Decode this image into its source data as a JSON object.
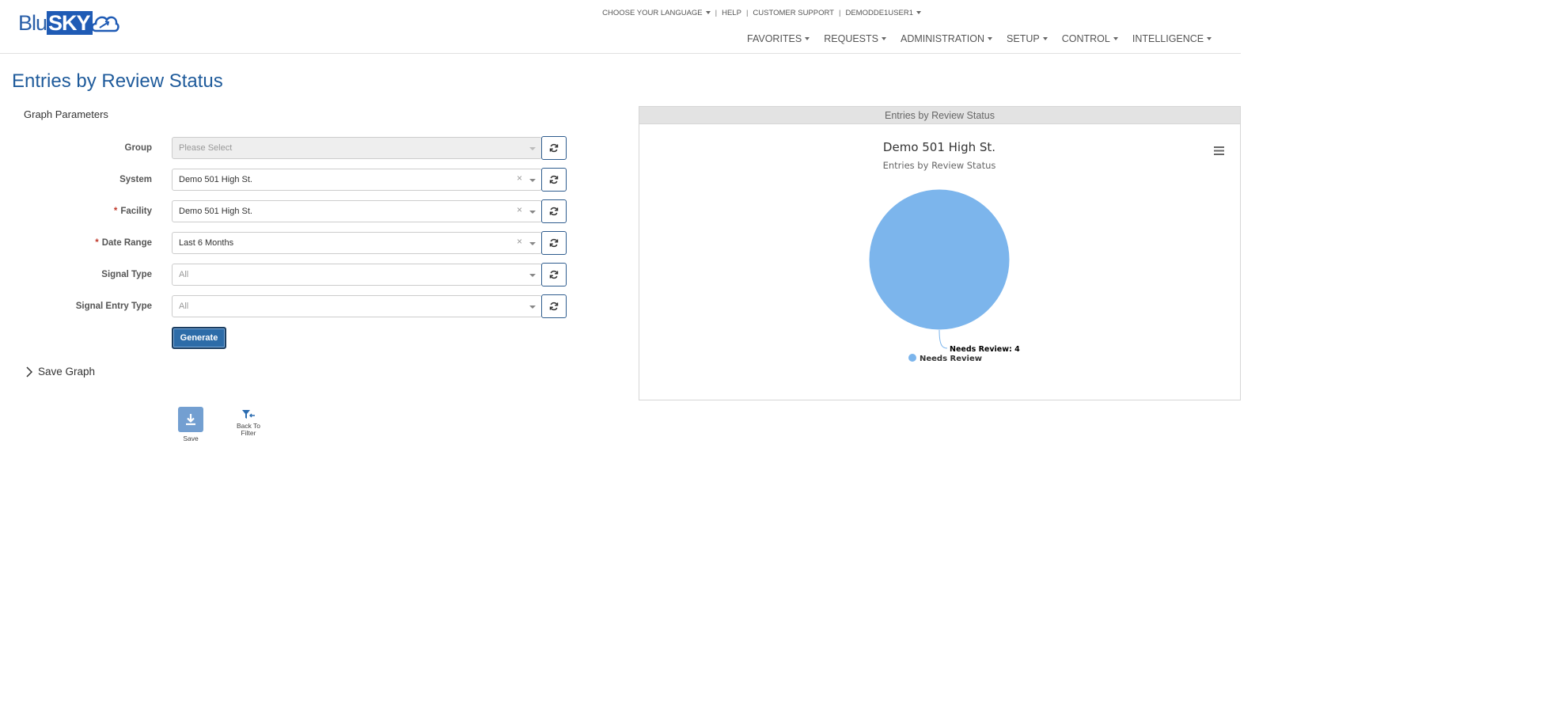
{
  "header": {
    "logo": {
      "part1": "Blu",
      "part2": "SKY"
    },
    "util_nav": {
      "language": "CHOOSE YOUR LANGUAGE",
      "help": "HELP",
      "support": "CUSTOMER SUPPORT",
      "user": "DEMODDE1USER1"
    },
    "main_nav": [
      "FAVORITES",
      "REQUESTS",
      "ADMINISTRATION",
      "SETUP",
      "CONTROL",
      "INTELLIGENCE"
    ]
  },
  "page": {
    "title": "Entries by Review Status",
    "params_title": "Graph Parameters"
  },
  "form": {
    "group": {
      "label": "Group",
      "value": "Please Select"
    },
    "system": {
      "label": "System",
      "value": "Demo 501 High St."
    },
    "facility": {
      "label": "Facility",
      "required": "*",
      "value": "Demo 501 High St."
    },
    "date_range": {
      "label": "Date Range",
      "required": "*",
      "value": "Last 6 Months"
    },
    "signal_type": {
      "label": "Signal Type",
      "value": "All"
    },
    "signal_entry_type": {
      "label": "Signal Entry Type",
      "value": "All"
    },
    "generate_label": "Generate"
  },
  "save_graph": {
    "label": "Save Graph"
  },
  "toolbar": {
    "save_label": "Save",
    "back_label_1": "Back To",
    "back_label_2": "Filter"
  },
  "chart_panel": {
    "header": "Entries by Review Status"
  },
  "colors": {
    "brand": "#1f5bb5",
    "title": "#1f5b9b",
    "pie": "#7cb5ec",
    "button": "#2d6ca8"
  },
  "chart_data": {
    "type": "pie",
    "title": "Demo 501 High St.",
    "subtitle": "Entries by Review Status",
    "slices": [
      {
        "name": "Needs Review",
        "value": 4,
        "color": "#7cb5ec"
      }
    ],
    "data_label_format": "Needs Review: 4",
    "legend": {
      "placement": "bottom",
      "items": [
        "Needs Review"
      ]
    }
  }
}
